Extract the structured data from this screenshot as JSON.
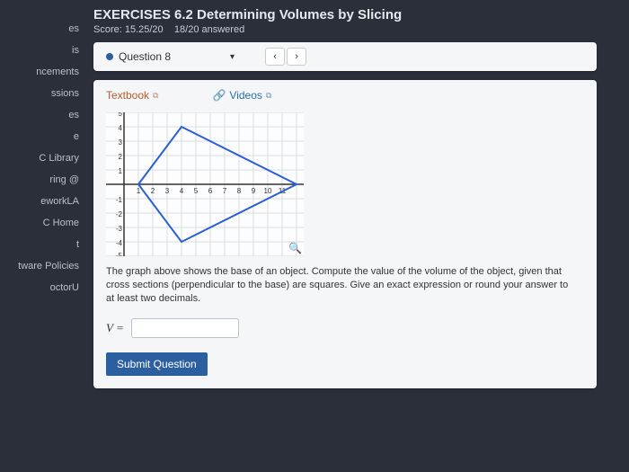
{
  "sidebar": {
    "items": [
      {
        "label": "es"
      },
      {
        "label": "is"
      },
      {
        "label": "ncements"
      },
      {
        "label": "ssions"
      },
      {
        "label": "es"
      },
      {
        "label": "e"
      },
      {
        "label": "C Library"
      },
      {
        "label": "ring @"
      },
      {
        "label": "eworkLA"
      },
      {
        "label": "C Home"
      },
      {
        "label": "t"
      },
      {
        "label": "tware Policies"
      },
      {
        "label": "octorU"
      }
    ]
  },
  "header": {
    "title": "EXERCISES 6.2 Determining Volumes by Slicing",
    "score": "Score: 15.25/20",
    "answered": "18/20 answered"
  },
  "question_bar": {
    "label": "Question 8",
    "prev": "‹",
    "next": "›"
  },
  "resources": {
    "textbook": "Textbook",
    "videos": "Videos"
  },
  "problem": {
    "text": "The graph above shows the base of an object. Compute the value of the volume of the object, given that cross sections (perpendicular to the base) are squares. Give an exact expression or round your answer to at least two decimals.",
    "var_label": "V =",
    "input_value": ""
  },
  "submit_label": "Submit Question",
  "chart_data": {
    "type": "line",
    "title": "",
    "xlabel": "",
    "ylabel": "",
    "xlim": [
      0,
      12
    ],
    "ylim": [
      -5,
      5
    ],
    "series": [
      {
        "name": "boundary",
        "x": [
          1,
          4,
          12,
          4,
          1
        ],
        "y": [
          0,
          4,
          0,
          -4,
          0
        ]
      }
    ],
    "grid": true
  }
}
